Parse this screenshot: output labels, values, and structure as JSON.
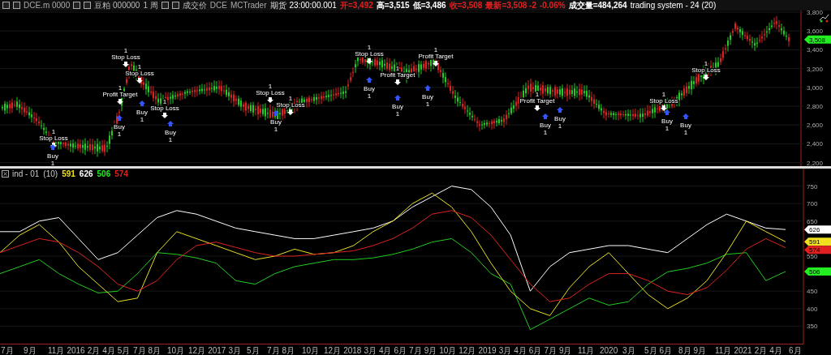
{
  "header": {
    "symbol": "DCE.m 0000",
    "name": "豆粕 000000",
    "period": "1 周",
    "price_type": "成交价",
    "exchange": "DCE",
    "source": "MCTrader",
    "category": "期货",
    "time": "23:00:00.001",
    "quotes": [
      {
        "text": "开=3,492",
        "color": "#e02020"
      },
      {
        "text": "高=3,515",
        "color": "#ffffff"
      },
      {
        "text": "低=3,486",
        "color": "#ffffff"
      },
      {
        "text": "收=3,508",
        "color": "#e02020"
      },
      {
        "text": "最新=3,508 -2",
        "color": "#e02020"
      },
      {
        "text": "-0.06%",
        "color": "#e02020"
      },
      {
        "text": "成交量=484,264",
        "color": "#ffffff"
      }
    ],
    "strategy": "trading system - 24 (20)"
  },
  "price_pane": {
    "yticks": [
      "3,800",
      "3,600",
      "3,400",
      "3,200",
      "3,000",
      "2,800",
      "2,600",
      "2,400",
      "2,200"
    ],
    "last_price": {
      "text": "3,508",
      "color": "#22ee22"
    },
    "markers": [
      {
        "kind": "sell",
        "label": "Stop Loss",
        "qty": "1"
      },
      {
        "kind": "buy",
        "label": "Buy",
        "qty": "1"
      },
      {
        "kind": "sell",
        "label": "Stop Loss",
        "qty": "1"
      },
      {
        "kind": "sell",
        "label": "Stop Loss",
        "qty": "1"
      },
      {
        "kind": "sell",
        "label": "Profit Target",
        "qty": "1"
      },
      {
        "kind": "buy",
        "label": "Buy",
        "qty": "1"
      },
      {
        "kind": "buy",
        "label": "Buy",
        "qty": "1"
      },
      {
        "kind": "sell",
        "label": "Stop Loss",
        "qty": "1"
      },
      {
        "kind": "buy",
        "label": "Buy",
        "qty": "1"
      },
      {
        "kind": "sell",
        "label": "Stop Loss",
        "qty": "1"
      },
      {
        "kind": "sell",
        "label": "Stop Loss",
        "qty": "1"
      },
      {
        "kind": "buy",
        "label": "Buy",
        "qty": "1"
      },
      {
        "kind": "sell",
        "label": "Stop Loss",
        "qty": "1"
      },
      {
        "kind": "buy",
        "label": "Buy",
        "qty": "1"
      },
      {
        "kind": "buy",
        "label": "Buy",
        "qty": "1"
      },
      {
        "kind": "sell",
        "label": "Profit Target",
        "qty": "1"
      },
      {
        "kind": "buy",
        "label": "Buy",
        "qty": "1"
      },
      {
        "kind": "sell",
        "label": "Profit Target",
        "qty": "1"
      },
      {
        "kind": "buy",
        "label": "Buy",
        "qty": "1"
      },
      {
        "kind": "sell",
        "label": "Profit Target",
        "qty": "1"
      },
      {
        "kind": "buy",
        "label": "Buy",
        "qty": "1"
      },
      {
        "kind": "sell",
        "label": "Stop Loss",
        "qty": "1"
      },
      {
        "kind": "buy",
        "label": "Buy",
        "qty": "1"
      },
      {
        "kind": "sell",
        "label": "Stop Loss",
        "qty": "1"
      },
      {
        "kind": "buy",
        "label": "Buy",
        "qty": "1"
      }
    ]
  },
  "indicator_pane": {
    "title": "ind - 01",
    "param": "(10)",
    "values": [
      {
        "text": "591",
        "color": "#f0e020"
      },
      {
        "text": "626",
        "color": "#ffffff"
      },
      {
        "text": "506",
        "color": "#22ee22"
      },
      {
        "text": "574",
        "color": "#e02020"
      }
    ],
    "chart_data": {
      "type": "line",
      "grid": true,
      "ylim": [
        300,
        800
      ],
      "yticks": [
        750,
        700,
        650,
        550,
        450,
        400,
        350
      ],
      "series": [
        {
          "color": "#ffffff",
          "values": [
            620,
            620,
            650,
            660,
            600,
            540,
            560,
            610,
            660,
            680,
            670,
            650,
            630,
            620,
            610,
            600,
            600,
            610,
            620,
            630,
            650,
            690,
            720,
            750,
            740,
            690,
            610,
            450,
            520,
            560,
            570,
            580,
            580,
            570,
            560,
            600,
            640,
            670,
            650,
            630,
            626
          ]
        },
        {
          "color": "#22cc22",
          "values": [
            500,
            520,
            540,
            500,
            470,
            445,
            450,
            500,
            560,
            555,
            545,
            530,
            480,
            470,
            500,
            520,
            530,
            540,
            540,
            545,
            555,
            570,
            590,
            600,
            560,
            500,
            470,
            340,
            370,
            400,
            430,
            410,
            420,
            470,
            505,
            515,
            530,
            555,
            560,
            480,
            506
          ]
        },
        {
          "color": "#e8e020",
          "values": [
            560,
            610,
            640,
            590,
            520,
            470,
            420,
            430,
            560,
            620,
            600,
            580,
            560,
            540,
            550,
            570,
            555,
            560,
            580,
            620,
            650,
            700,
            730,
            690,
            620,
            530,
            450,
            400,
            380,
            460,
            520,
            560,
            500,
            440,
            400,
            430,
            480,
            560,
            650,
            620,
            591
          ]
        },
        {
          "color": "#dd2222",
          "values": [
            560,
            580,
            600,
            590,
            560,
            520,
            470,
            450,
            480,
            540,
            580,
            590,
            575,
            560,
            550,
            550,
            555,
            560,
            565,
            580,
            600,
            630,
            670,
            680,
            660,
            610,
            540,
            470,
            420,
            430,
            470,
            500,
            500,
            480,
            450,
            440,
            460,
            510,
            570,
            600,
            574
          ]
        }
      ]
    },
    "axis_labels": [
      {
        "text": "626",
        "color": "#ffffff"
      },
      {
        "text": "591",
        "color": "#f0e020"
      },
      {
        "text": "574",
        "color": "#e02020"
      },
      {
        "text": "506",
        "color": "#22ee22"
      }
    ]
  },
  "time_axis": [
    "7月",
    "9月",
    "11月",
    "2016",
    "2月",
    "4月",
    "5月",
    "7月",
    "8月",
    "10月",
    "12月",
    "2017",
    "3月",
    "5月",
    "7月",
    "8月",
    "10月",
    "12月",
    "2018",
    "3月",
    "4月",
    "6月",
    "7月",
    "9月",
    "10月",
    "12月",
    "2019",
    "3月",
    "4月",
    "6月",
    "7月",
    "9月",
    "11月",
    "2020",
    "3月",
    "5月",
    "6月",
    "8月",
    "9月",
    "11月",
    "2021",
    "2月",
    "4月",
    "6月"
  ]
}
